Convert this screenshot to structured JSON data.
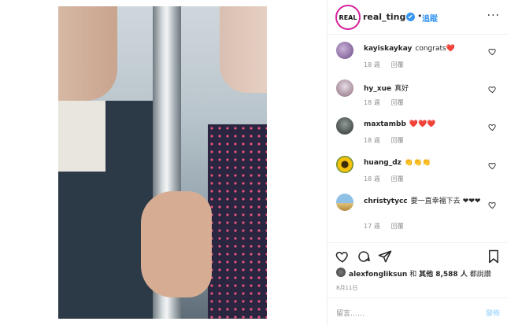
{
  "header": {
    "logo_text": "REAL",
    "username": "real_ting",
    "verified_mark": "✔",
    "separator": "•",
    "follow_label": "追蹤",
    "more_label": "···"
  },
  "comments": [
    {
      "avatar": "avatar-kayiskaykay",
      "username": "kayiskaykay",
      "text": "congrats",
      "emoji": "❤️",
      "time": "18 週",
      "reply": "回覆"
    },
    {
      "avatar": "avatar-hy-xue",
      "username": "hy_xue",
      "text": "真好",
      "emoji": "",
      "time": "18 週",
      "reply": "回覆"
    },
    {
      "avatar": "avatar-maxtambb",
      "username": "maxtambb",
      "text": "",
      "emoji": "❤️❤️❤️",
      "time": "18 週",
      "reply": "回覆"
    },
    {
      "avatar": "avatar-huang-dz",
      "username": "huang_dz",
      "text": "",
      "emoji": "👏👏👏",
      "time": "18 週",
      "reply": "回覆"
    },
    {
      "avatar": "avatar-christytycc",
      "username": "christytycc",
      "text": "要一直幸福下去",
      "emoji": "❤❤❤",
      "time": "17 週",
      "reply": "回覆"
    }
  ],
  "likes": {
    "liker": "alexfongliksun",
    "middle": " 和 ",
    "others": "其他 8,588 人",
    "suffix": " 都說讚"
  },
  "date": "8月11日",
  "add_comment": {
    "placeholder": "留言……",
    "post_label": "發佈"
  },
  "colors": {
    "accent": "#3897f0",
    "heart": "#ed1c24",
    "muted": "#8e8e8e",
    "post_disabled": "#b2dffc"
  }
}
